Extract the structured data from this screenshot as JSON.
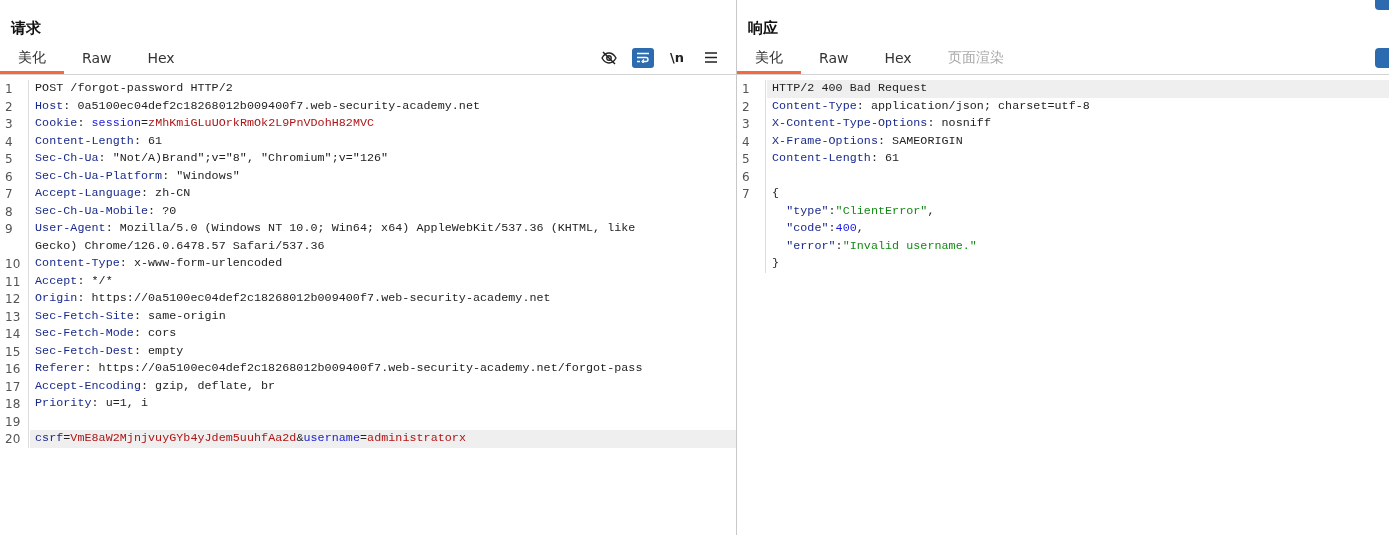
{
  "request": {
    "title": "请求",
    "tabs": [
      {
        "label": "美化",
        "selected": true,
        "disabled": false
      },
      {
        "label": "Raw",
        "selected": false,
        "disabled": false
      },
      {
        "label": "Hex",
        "selected": false,
        "disabled": false
      }
    ],
    "toolbar": [
      {
        "kind": "hide-icon",
        "active": false
      },
      {
        "kind": "wrap-icon",
        "active": true
      },
      {
        "kind": "text",
        "label": "\\n",
        "active": false
      },
      {
        "kind": "menu-icon",
        "active": false
      }
    ],
    "lines": [
      {
        "number": "1",
        "highlighted": false,
        "tokens": [
          {
            "kind": "plain",
            "text": "POST /forgot-password HTTP/2"
          }
        ]
      },
      {
        "number": "2",
        "highlighted": false,
        "tokens": [
          {
            "kind": "key",
            "text": "Host"
          },
          {
            "kind": "plain",
            "text": ": 0a5100ec04def2c18268012b009400f7.web-security-academy.net"
          }
        ]
      },
      {
        "number": "3",
        "highlighted": false,
        "tokens": [
          {
            "kind": "key",
            "text": "Cookie"
          },
          {
            "kind": "plain",
            "text": ": "
          },
          {
            "kind": "param",
            "text": "session"
          },
          {
            "kind": "plain",
            "text": "="
          },
          {
            "kind": "value",
            "text": "zMhKmiGLuUOrkRmOk2L9PnVDohH82MVC"
          }
        ]
      },
      {
        "number": "4",
        "highlighted": false,
        "tokens": [
          {
            "kind": "key",
            "text": "Content-Length"
          },
          {
            "kind": "plain",
            "text": ": 61"
          }
        ]
      },
      {
        "number": "5",
        "highlighted": false,
        "tokens": [
          {
            "kind": "key",
            "text": "Sec-Ch-Ua"
          },
          {
            "kind": "plain",
            "text": ": \"Not/A)Brand\";v=\"8\", \"Chromium\";v=\"126\""
          }
        ]
      },
      {
        "number": "6",
        "highlighted": false,
        "tokens": [
          {
            "kind": "key",
            "text": "Sec-Ch-Ua-Platform"
          },
          {
            "kind": "plain",
            "text": ": \"Windows\""
          }
        ]
      },
      {
        "number": "7",
        "highlighted": false,
        "tokens": [
          {
            "kind": "key",
            "text": "Accept-Language"
          },
          {
            "kind": "plain",
            "text": ": zh-CN"
          }
        ]
      },
      {
        "number": "8",
        "highlighted": false,
        "tokens": [
          {
            "kind": "key",
            "text": "Sec-Ch-Ua-Mobile"
          },
          {
            "kind": "plain",
            "text": ": ?0"
          }
        ]
      },
      {
        "number": "9",
        "highlighted": false,
        "tokens": [
          {
            "kind": "key",
            "text": "User-Agent"
          },
          {
            "kind": "plain",
            "text": ": Mozilla/5.0 (Windows NT 10.0; Win64; x64) AppleWebKit/537.36 (KHTML, like"
          }
        ]
      },
      {
        "highlighted": false,
        "tokens": [
          {
            "kind": "plain",
            "text": "Gecko) Chrome/126.0.6478.57 Safari/537.36"
          }
        ]
      },
      {
        "number": "10",
        "highlighted": false,
        "tokens": [
          {
            "kind": "key",
            "text": "Content-Type"
          },
          {
            "kind": "plain",
            "text": ": x-www-form-urlencoded"
          }
        ]
      },
      {
        "number": "11",
        "highlighted": false,
        "tokens": [
          {
            "kind": "key",
            "text": "Accept"
          },
          {
            "kind": "plain",
            "text": ": */*"
          }
        ]
      },
      {
        "number": "12",
        "highlighted": false,
        "tokens": [
          {
            "kind": "key",
            "text": "Origin"
          },
          {
            "kind": "plain",
            "text": ": https://0a5100ec04def2c18268012b009400f7.web-security-academy.net"
          }
        ]
      },
      {
        "number": "13",
        "highlighted": false,
        "tokens": [
          {
            "kind": "key",
            "text": "Sec-Fetch-Site"
          },
          {
            "kind": "plain",
            "text": ": same-origin"
          }
        ]
      },
      {
        "number": "14",
        "highlighted": false,
        "tokens": [
          {
            "kind": "key",
            "text": "Sec-Fetch-Mode"
          },
          {
            "kind": "plain",
            "text": ": cors"
          }
        ]
      },
      {
        "number": "15",
        "highlighted": false,
        "tokens": [
          {
            "kind": "key",
            "text": "Sec-Fetch-Dest"
          },
          {
            "kind": "plain",
            "text": ": empty"
          }
        ]
      },
      {
        "number": "16",
        "highlighted": false,
        "tokens": [
          {
            "kind": "key",
            "text": "Referer"
          },
          {
            "kind": "plain",
            "text": ": https://0a5100ec04def2c18268012b009400f7.web-security-academy.net/forgot-pass"
          }
        ]
      },
      {
        "number": "17",
        "highlighted": false,
        "tokens": [
          {
            "kind": "key",
            "text": "Accept-Encoding"
          },
          {
            "kind": "plain",
            "text": ": gzip, deflate, br"
          }
        ]
      },
      {
        "number": "18",
        "highlighted": false,
        "tokens": [
          {
            "kind": "key",
            "text": "Priority"
          },
          {
            "kind": "plain",
            "text": ": u=1, i"
          }
        ]
      },
      {
        "number": "19",
        "highlighted": false
      },
      {
        "number": "20",
        "highlighted": true,
        "tokens": [
          {
            "kind": "key",
            "text": "csrf"
          },
          {
            "kind": "plain",
            "text": "="
          },
          {
            "kind": "value",
            "text": "VmE8aW2MjnjvuyGYb4yJdem5uuhfAa2d"
          },
          {
            "kind": "plain",
            "text": "&"
          },
          {
            "kind": "param",
            "text": "username"
          },
          {
            "kind": "plain",
            "text": "="
          },
          {
            "kind": "value",
            "text": "administratorx"
          }
        ]
      }
    ]
  },
  "response": {
    "title": "响应",
    "tabs": [
      {
        "label": "美化",
        "selected": true,
        "disabled": false
      },
      {
        "label": "Raw",
        "selected": false,
        "disabled": false
      },
      {
        "label": "Hex",
        "selected": false,
        "disabled": false
      },
      {
        "label": "页面渲染",
        "selected": false,
        "disabled": true
      }
    ],
    "lines": [
      {
        "number": "1",
        "highlighted": true,
        "tokens": [
          {
            "kind": "plain",
            "text": "HTTP/2 400 Bad Request"
          }
        ]
      },
      {
        "number": "2",
        "highlighted": false,
        "tokens": [
          {
            "kind": "key",
            "text": "Content-Type"
          },
          {
            "kind": "plain",
            "text": ": application/json; charset=utf-8"
          }
        ]
      },
      {
        "number": "3",
        "highlighted": false,
        "tokens": [
          {
            "kind": "key",
            "text": "X-Content-Type-Options"
          },
          {
            "kind": "plain",
            "text": ": nosniff"
          }
        ]
      },
      {
        "number": "4",
        "highlighted": false,
        "tokens": [
          {
            "kind": "key",
            "text": "X-Frame-Options"
          },
          {
            "kind": "plain",
            "text": ": SAMEORIGIN"
          }
        ]
      },
      {
        "number": "5",
        "highlighted": false,
        "tokens": [
          {
            "kind": "key",
            "text": "Content-Length"
          },
          {
            "kind": "plain",
            "text": ": 61"
          }
        ]
      },
      {
        "number": "6",
        "highlighted": false
      },
      {
        "number": "7",
        "highlighted": false,
        "tokens": [
          {
            "kind": "plain",
            "text": "{"
          }
        ]
      },
      {
        "highlighted": false,
        "tokens": [
          {
            "kind": "key",
            "text": "  \"type\""
          },
          {
            "kind": "plain",
            "text": ":"
          },
          {
            "kind": "str",
            "text": "\"ClientError\""
          },
          {
            "kind": "plain",
            "text": ","
          }
        ]
      },
      {
        "highlighted": false,
        "tokens": [
          {
            "kind": "key",
            "text": "  \"code\""
          },
          {
            "kind": "plain",
            "text": ":"
          },
          {
            "kind": "num",
            "text": "400"
          },
          {
            "kind": "plain",
            "text": ","
          }
        ]
      },
      {
        "highlighted": false,
        "tokens": [
          {
            "kind": "key",
            "text": "  \"error\""
          },
          {
            "kind": "plain",
            "text": ":"
          },
          {
            "kind": "str",
            "text": "\"Invalid username.\""
          }
        ]
      },
      {
        "highlighted": false,
        "tokens": [
          {
            "kind": "plain",
            "text": "}"
          }
        ]
      }
    ]
  }
}
